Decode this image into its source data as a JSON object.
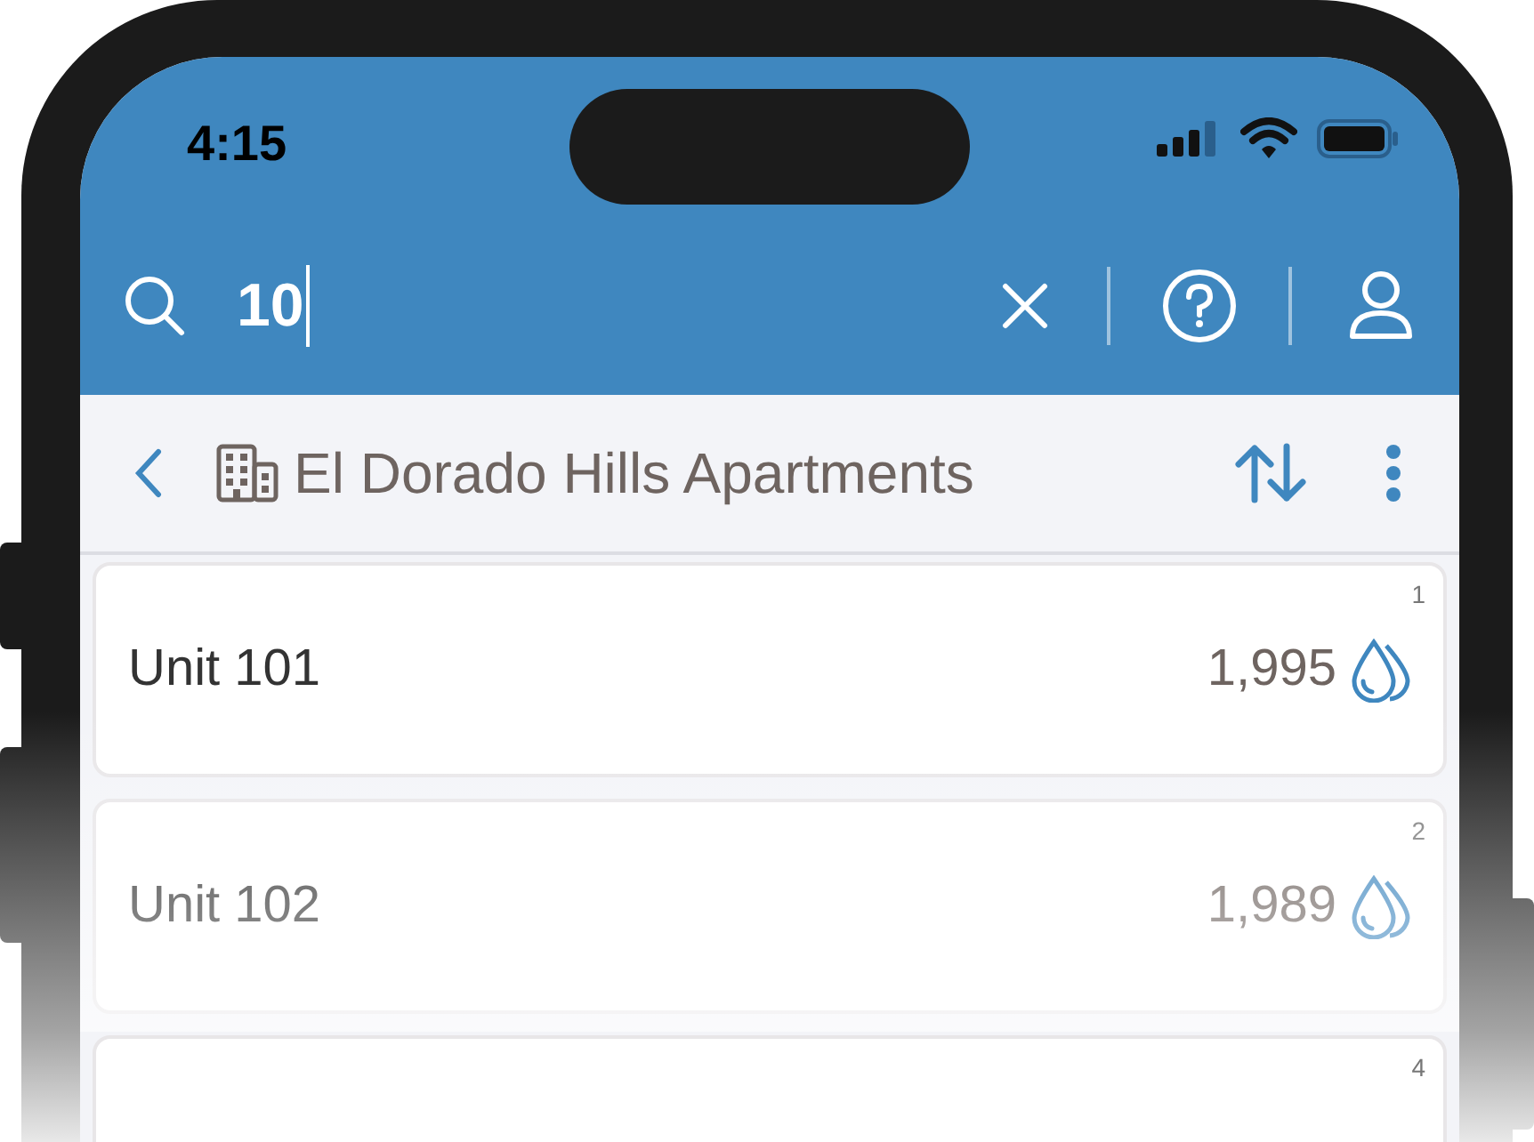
{
  "status_bar": {
    "time": "4:15"
  },
  "search": {
    "value": "10"
  },
  "header": {
    "title": "El Dorado Hills Apartments"
  },
  "units": [
    {
      "rank": "1",
      "name": "Unit 101",
      "value": "1,995"
    },
    {
      "rank": "2",
      "name": "Unit 102",
      "value": "1,989"
    },
    {
      "rank": "4"
    }
  ]
}
